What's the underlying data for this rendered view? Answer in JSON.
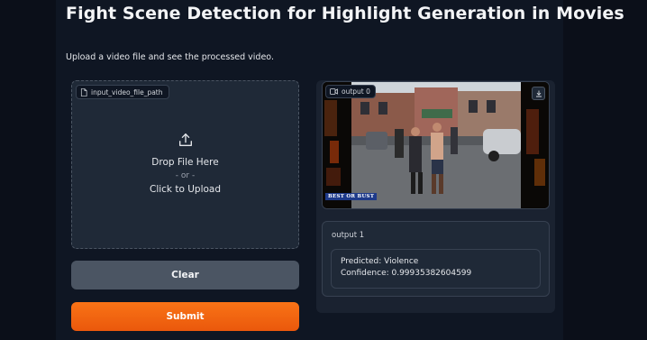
{
  "header": {
    "title": "Fight Scene Detection for Highlight Generation in Movies",
    "description": "Upload a video file and see the processed video."
  },
  "input": {
    "label": "input_video_file_path",
    "drop_text": "Drop File Here",
    "or_text": "- or -",
    "click_text": "Click to Upload",
    "icon": "upload-icon"
  },
  "buttons": {
    "clear_label": "Clear",
    "submit_label": "Submit"
  },
  "outputs": {
    "video": {
      "label": "output 0",
      "watermark": "BEST OR BUST",
      "icon": "video-icon"
    },
    "text": {
      "label": "output 1",
      "line1": "Predicted: Violence",
      "line2": "Confidence: 0.99935382604599"
    }
  },
  "colors": {
    "background": "#0b0f19",
    "panel": "#1f2937",
    "accent": "#f97316",
    "secondary_button": "#4b5563"
  }
}
